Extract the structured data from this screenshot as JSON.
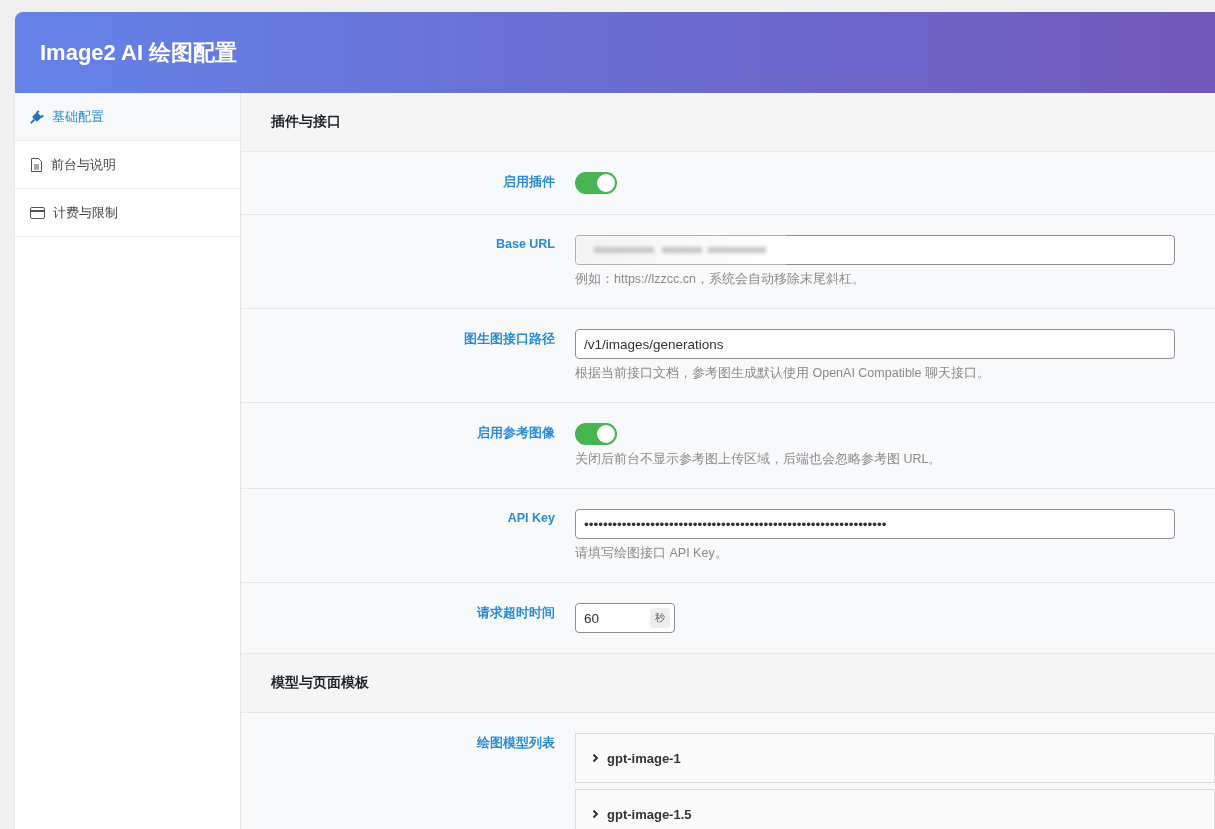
{
  "window": {
    "title": "Image2 AI 绘图配置"
  },
  "sidebar": {
    "items": [
      {
        "label": "基础配置",
        "selected": true
      },
      {
        "label": "前台与说明",
        "selected": false
      },
      {
        "label": "计费与限制",
        "selected": false
      }
    ]
  },
  "sections": [
    {
      "title": "插件与接口",
      "rows": [
        {
          "kind": "toggle",
          "label": "启用插件",
          "on": true
        },
        {
          "kind": "text",
          "label": "Base URL",
          "redacted": true,
          "hint": "例如：https://lzzcc.cn，系统会自动移除末尾斜杠。"
        },
        {
          "kind": "text",
          "label": "图生图接口路径",
          "value": "/v1/images/generations",
          "hint": "根据当前接口文档，参考图生成默认使用 OpenAI Compatible 聊天接口。"
        },
        {
          "kind": "toggle",
          "label": "启用参考图像",
          "on": true,
          "hint": "关闭后前台不显示参考图上传区域，后端也会忽略参考图 URL。"
        },
        {
          "kind": "text",
          "label": "API Key",
          "value": "••••••••••••••••••••••••••••••••••••••••••••••••••••••••••••••••",
          "hint": "请填写绘图接口 API Key。"
        },
        {
          "kind": "number",
          "label": "请求超时时间",
          "value": "60",
          "unit": "秒"
        }
      ]
    },
    {
      "title": "模型与页面模板",
      "rows": [
        {
          "kind": "list",
          "label": "绘图模型列表",
          "items": [
            {
              "label": "gpt-image-1",
              "expanded": false
            },
            {
              "label": "gpt-image-1.5",
              "expanded": false
            }
          ]
        }
      ]
    }
  ]
}
